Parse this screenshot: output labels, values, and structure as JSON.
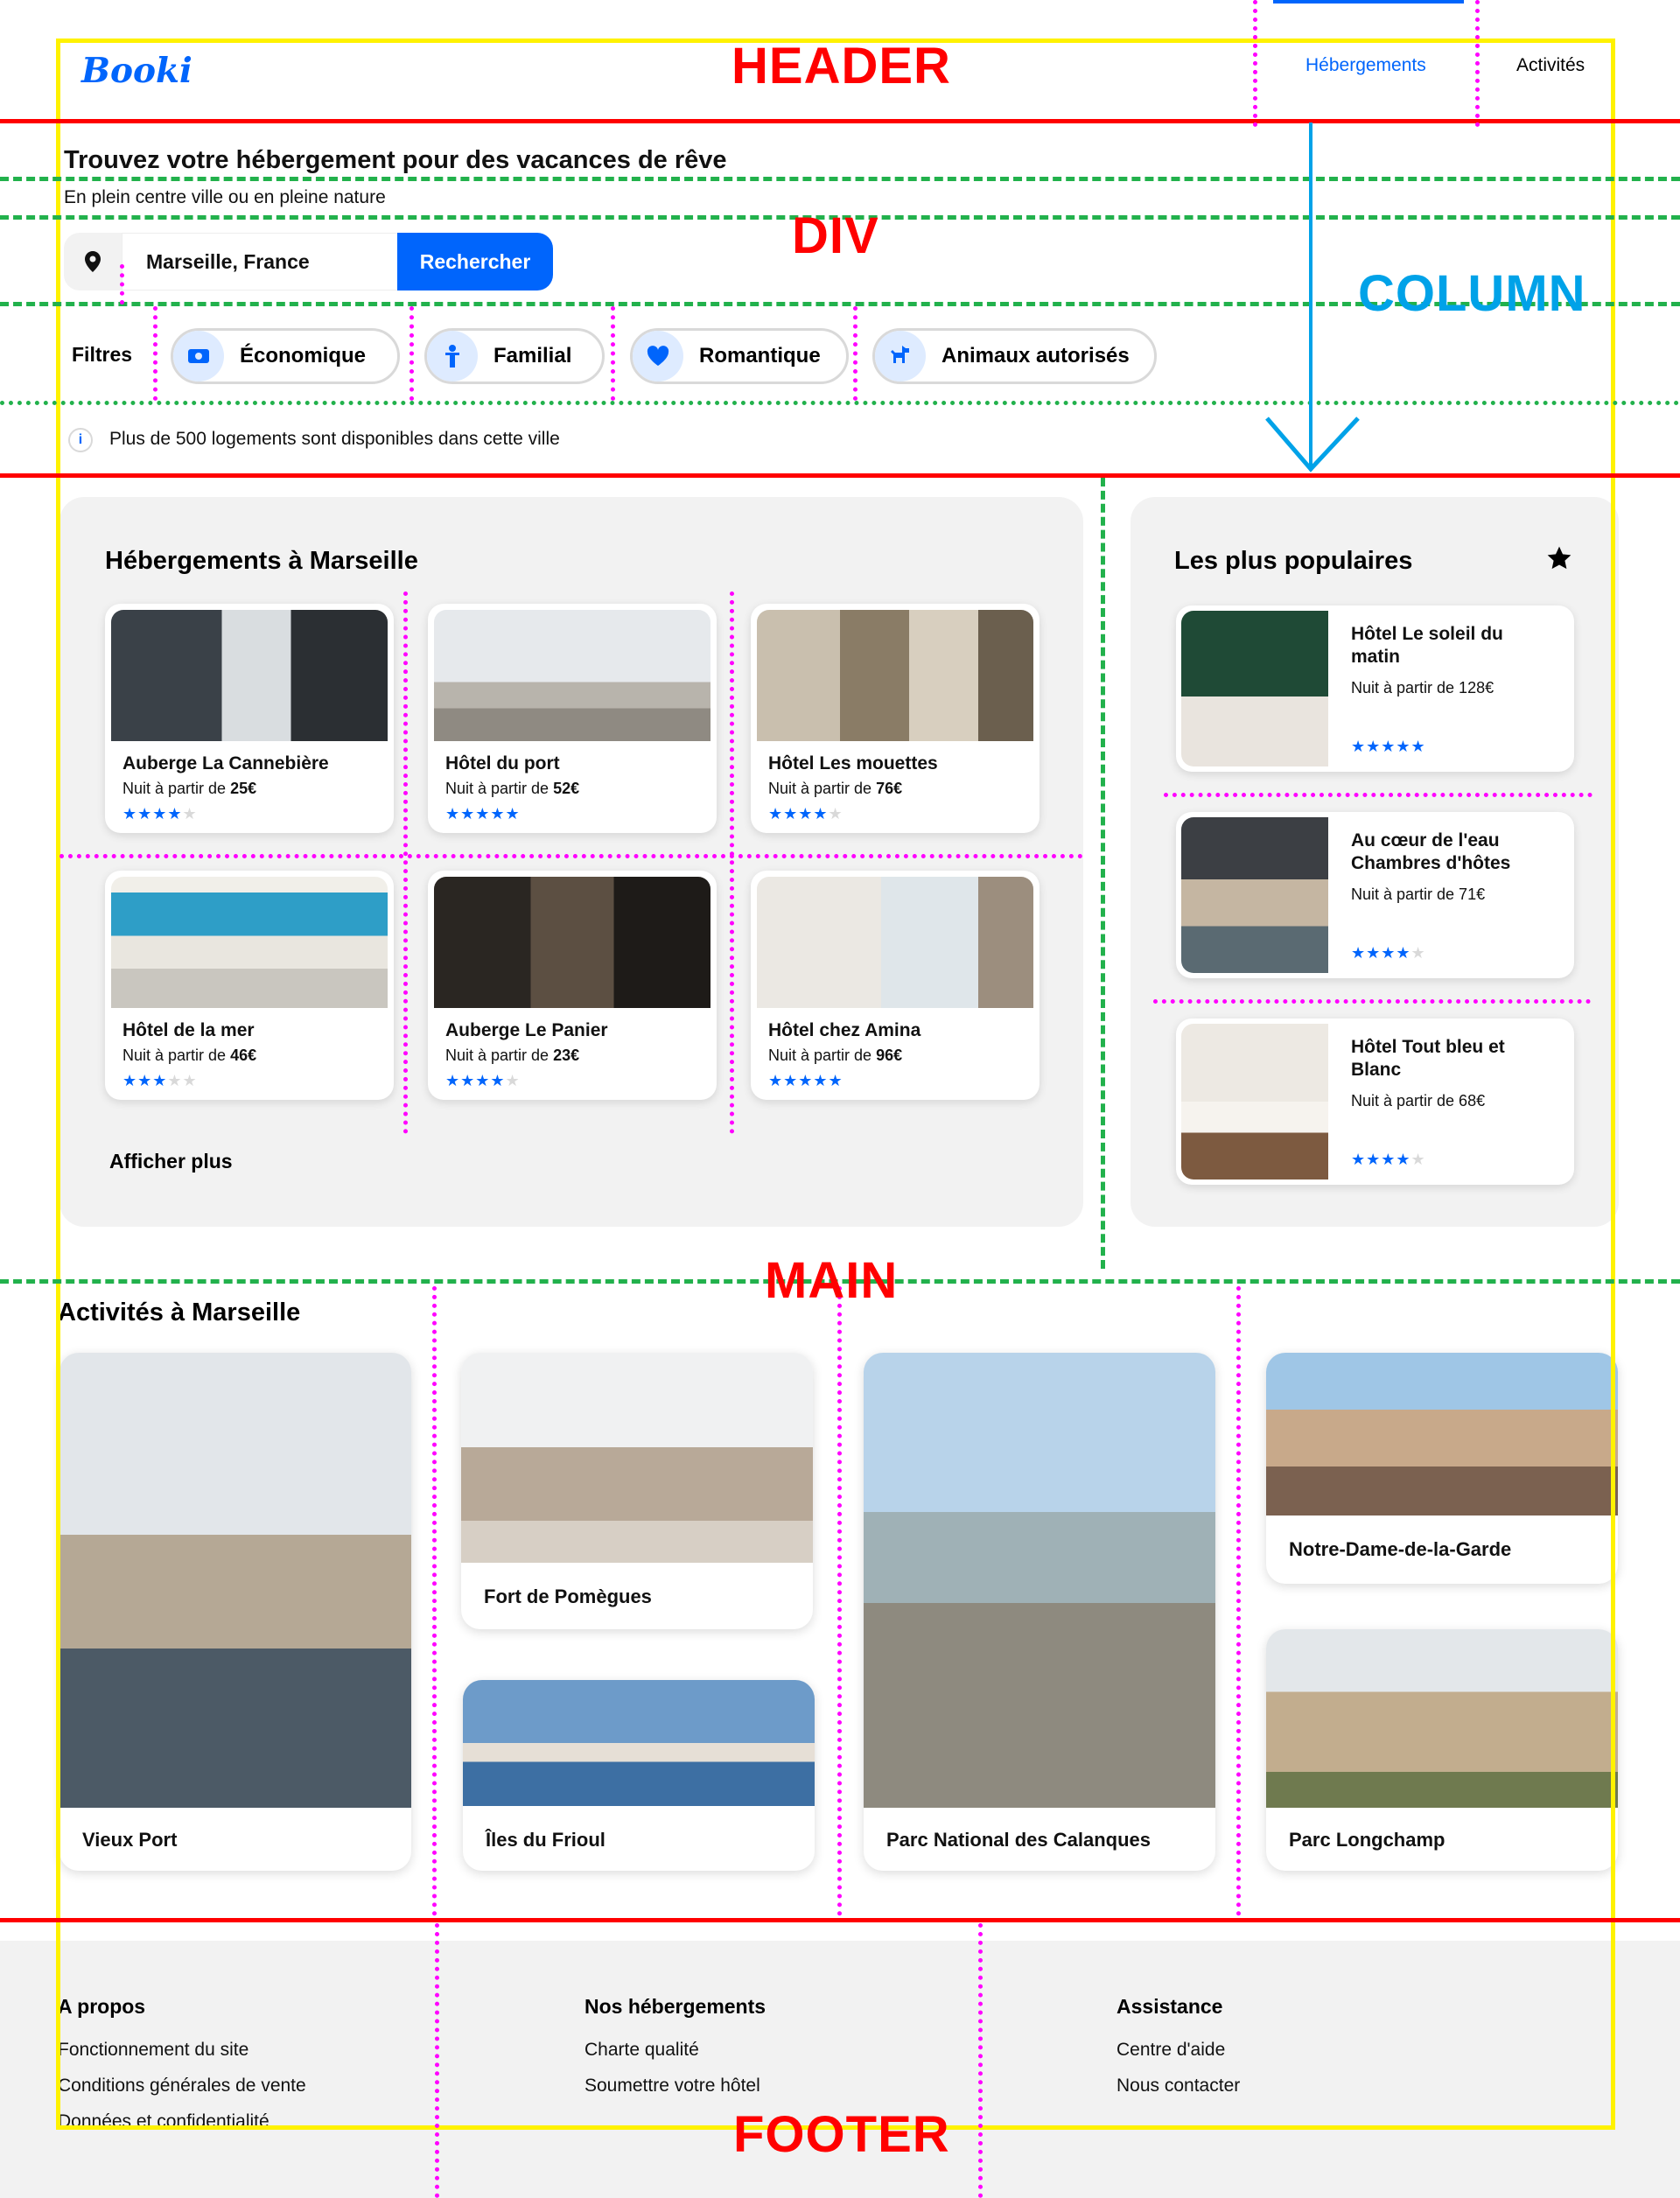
{
  "header": {
    "logo": "Booki",
    "nav": [
      "Hébergements",
      "Activités"
    ]
  },
  "hero": {
    "title": "Trouvez votre hébergement pour des vacances de rêve",
    "subtitle": "En plein centre ville ou en pleine nature"
  },
  "search": {
    "value": "Marseille, France",
    "button": "Rechercher"
  },
  "filters": {
    "label": "Filtres",
    "items": [
      "Économique",
      "Familial",
      "Romantique",
      "Animaux autorisés"
    ]
  },
  "info": {
    "text": "Plus de 500 logements sont disponibles dans cette ville"
  },
  "accommodations": {
    "title": "Hébergements à Marseille",
    "more": "Afficher plus",
    "items": [
      {
        "name": "Auberge La Cannebière",
        "price_prefix": "Nuit à partir de",
        "price": "25€",
        "rating": 4
      },
      {
        "name": "Hôtel du port",
        "price_prefix": "Nuit à partir de",
        "price": "52€",
        "rating": 5
      },
      {
        "name": "Hôtel Les mouettes",
        "price_prefix": "Nuit à partir de",
        "price": "76€",
        "rating": 4
      },
      {
        "name": "Hôtel de la mer",
        "price_prefix": "Nuit à partir de",
        "price": "46€",
        "rating": 3
      },
      {
        "name": "Auberge Le Panier",
        "price_prefix": "Nuit à partir de",
        "price": "23€",
        "rating": 4
      },
      {
        "name": "Hôtel chez Amina",
        "price_prefix": "Nuit à partir de",
        "price": "96€",
        "rating": 5
      }
    ]
  },
  "popular": {
    "title": "Les plus populaires",
    "items": [
      {
        "name": "Hôtel Le soleil du matin",
        "price": "Nuit à partir de 128€",
        "rating": 5
      },
      {
        "name": "Au cœur de l'eau Chambres d'hôtes",
        "price": "Nuit à partir de 71€",
        "rating": 4
      },
      {
        "name": "Hôtel Tout bleu et Blanc",
        "price": "Nuit à partir de 68€",
        "rating": 4
      }
    ]
  },
  "activities": {
    "title": "Activités à Marseille",
    "items": [
      "Vieux Port",
      "Fort de Pomègues",
      "Îles du Frioul",
      "Parc National des Calanques",
      "Notre-Dame-de-la-Garde",
      "Parc Longchamp"
    ]
  },
  "footer": {
    "columns": [
      {
        "title": "A propos",
        "links": [
          "Fonctionnement du site",
          "Conditions générales de vente",
          "Données et confidentialité"
        ]
      },
      {
        "title": "Nos hébergements",
        "links": [
          "Charte qualité",
          "Soumettre votre hôtel"
        ]
      },
      {
        "title": "Assistance",
        "links": [
          "Centre d'aide",
          "Nous contacter"
        ]
      }
    ]
  },
  "annotations": {
    "header": "HEADER",
    "div": "DIV",
    "column": "COLUMN",
    "main": "MAIN",
    "footer": "FOOTER"
  },
  "colors": {
    "accent": "#0065FC",
    "annotation_red": "#FF0000",
    "annotation_yellow": "#FFF200",
    "annotation_green": "#22B14C",
    "annotation_magenta": "#FF00FF",
    "annotation_blue": "#00A2E8"
  }
}
